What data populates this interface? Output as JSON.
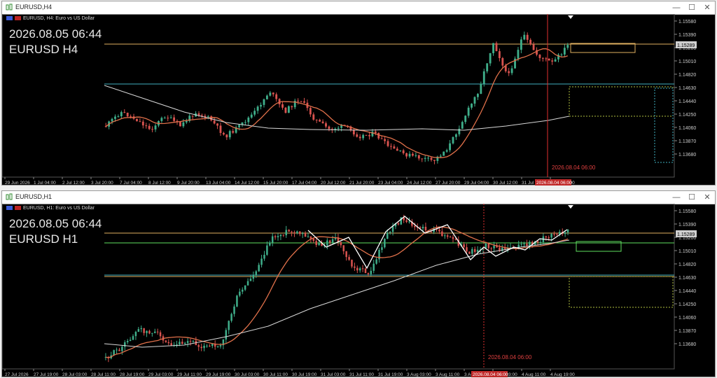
{
  "windows": [
    {
      "title": "EURUSD,H4",
      "header": "EURUSD, H4:  Euro vs US Dollar",
      "overlay_time": "2026.08.05 06:44",
      "overlay_symbol": "EURUSD H4",
      "price_labels": [
        "1.15580",
        "1.15390",
        "1.15200",
        "1.15010",
        "1.14820",
        "1.14630",
        "1.14440",
        "1.14250",
        "1.14060",
        "1.13870",
        "1.13680"
      ],
      "current_price": "1.15289",
      "time_labels": [
        "29 Jun 2026",
        "1 Jul 04:00",
        "2 Jul 12:00",
        "3 Jul 20:00",
        "7 Jul 04:00",
        "8 Jul 12:00",
        "9 Jul 20:00",
        "13 Jul 04:00",
        "14 Jul 12:00",
        "15 Jul 20:00",
        "17 Jul 04:00",
        "20 Jul 12:00",
        "21 Jul 20:00",
        "23 Jul 04:00",
        "24 Jul 12:00",
        "27 Jul 20:00",
        "29 Jul 04:00",
        "30 Jul 12:00",
        "31 Jul 20:00",
        "4 Aug 04:00"
      ],
      "vline_label": "2026.08.04 06:00",
      "vline_axis_label": "2026.08.04 06:00"
    },
    {
      "title": "EURUSD,H1",
      "header": "EURUSD, H1:  Euro vs US Dollar",
      "overlay_time": "2026.08.05 06:44",
      "overlay_symbol": "EURUSD H1",
      "price_labels": [
        "1.15580",
        "1.15390",
        "1.15200",
        "1.15010",
        "1.14820",
        "1.14630",
        "1.14440",
        "1.14250",
        "1.14060",
        "1.13870",
        "1.13680"
      ],
      "current_price": "1.15289",
      "time_labels": [
        "27 Jul 2026",
        "27 Jul 19:00",
        "28 Jul 03:00",
        "28 Jul 11:00",
        "28 Jul 19:00",
        "29 Jul 03:00",
        "29 Jul 11:00",
        "29 Jul 19:00",
        "30 Jul 03:00",
        "30 Jul 11:00",
        "30 Jul 19:00",
        "31 Jul 03:00",
        "31 Jul 11:00",
        "31 Jul 19:00",
        "3 Aug 03:00",
        "3 Aug 11:00",
        "3 Aug 19:00",
        "4 Aug 03:00",
        "4 Aug 11:00",
        "4 Aug 19:00"
      ],
      "vline_label": "2026.08.04 06:00",
      "vline_axis_label": "2026.08.04 06:00"
    }
  ],
  "buttons": {
    "minimize": "—",
    "maximize": "☐",
    "close": "✕"
  },
  "colors": {
    "bull": "#3fae8a",
    "bear": "#d9534f",
    "ma_fast": "#e0704a",
    "ma_slow": "#d8d8d8",
    "level_gold": "#e0b060",
    "level_cyan": "#40b0c0",
    "zigzag": "#ffffff",
    "vline": "#e03030"
  }
}
